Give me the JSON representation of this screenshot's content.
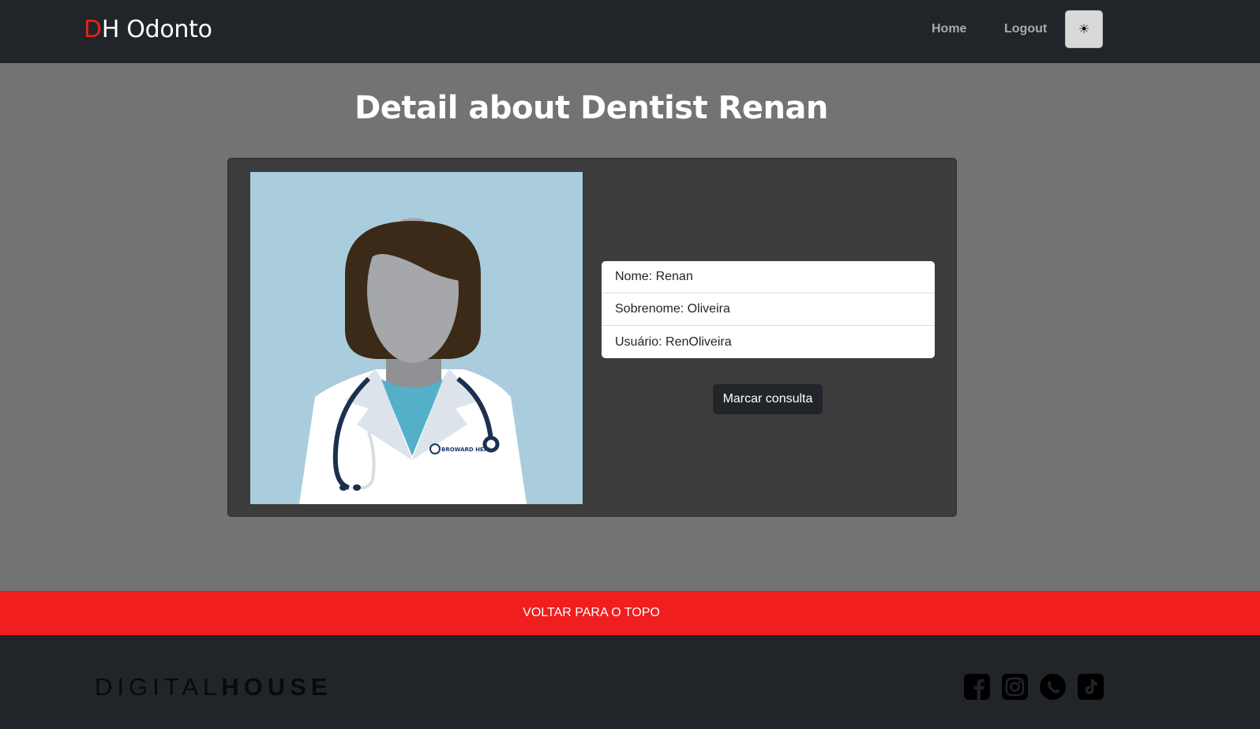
{
  "navbar": {
    "brand_first": "D",
    "brand_rest": "H Odonto",
    "links": {
      "home": "Home",
      "logout": "Logout"
    },
    "theme_toggle_icon": "☀"
  },
  "main": {
    "title": "Detail about Dentist Renan",
    "photo": {
      "alt_icon": "doctor-avatar-illustration",
      "badge_text": "BROWARD HEAL"
    },
    "details": [
      {
        "label": "Nome: Renan"
      },
      {
        "label": "Sobrenome: Oliveira"
      },
      {
        "label": "Usuário: RenOliveira"
      }
    ],
    "book_button": "Marcar consulta"
  },
  "back_to_top": "VOLTAR PARA O TOPO",
  "footer": {
    "logo_light": "DIGITAL",
    "logo_bold": "HOUSE",
    "social_icons": [
      "facebook-icon",
      "instagram-icon",
      "whatsapp-icon",
      "tiktok-icon"
    ]
  },
  "colors": {
    "navbar_bg": "#212429",
    "page_bg": "#737373",
    "card_bg": "#3c3c3c",
    "accent_red": "#f01e1e",
    "brand_red": "#e8201f"
  }
}
